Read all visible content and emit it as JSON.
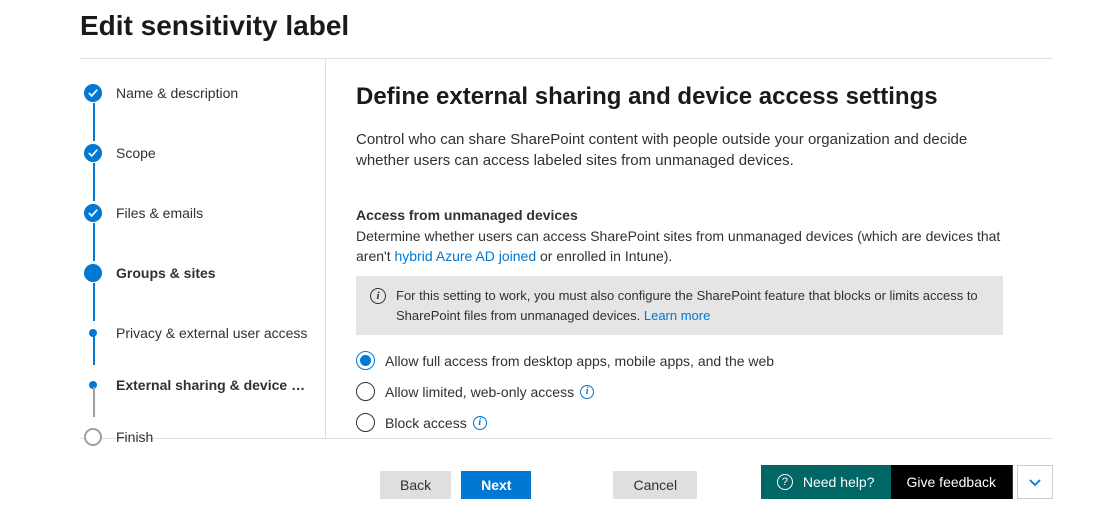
{
  "page_title": "Edit sensitivity label",
  "wizard_steps": {
    "s0": {
      "label": "Name & description"
    },
    "s1": {
      "label": "Scope"
    },
    "s2": {
      "label": "Files & emails"
    },
    "s3": {
      "label": "Groups & sites"
    },
    "s4": {
      "label": "Privacy & external user access"
    },
    "s5": {
      "label": "External sharing & device ac..."
    },
    "s6": {
      "label": "Finish"
    }
  },
  "main": {
    "heading": "Define external sharing and device access settings",
    "description": "Control who can share SharePoint content with people outside your organization and decide whether users can access labeled sites from unmanaged devices.",
    "section_title": "Access from unmanaged devices",
    "section_desc_a": "Determine whether users can access SharePoint sites from unmanaged devices (which are devices that aren't ",
    "section_desc_link": "hybrid Azure AD joined",
    "section_desc_b": " or enrolled in Intune).",
    "info_text": "For this setting to work, you must also configure the SharePoint feature that blocks or limits access to SharePoint files from unmanaged devices.  ",
    "info_link": "Learn more",
    "radios": {
      "r0": "Allow full access from desktop apps, mobile apps, and the web",
      "r1": "Allow limited, web-only access",
      "r2": "Block access"
    }
  },
  "footer": {
    "back": "Back",
    "next": "Next",
    "cancel": "Cancel",
    "need_help": "Need help?",
    "give_feedback": "Give feedback"
  }
}
